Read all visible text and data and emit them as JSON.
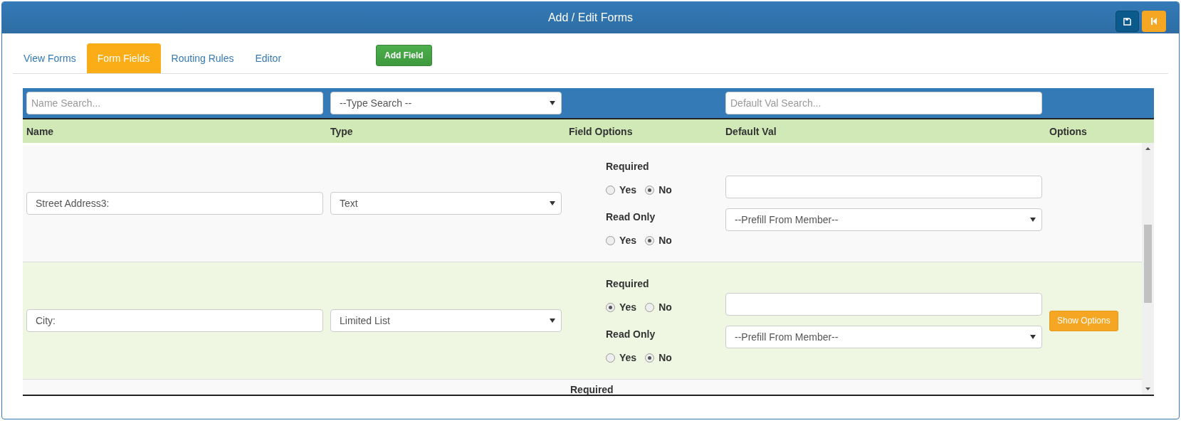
{
  "window": {
    "title": "Add / Edit Forms"
  },
  "tabs": [
    {
      "label": "View Forms",
      "selected": false
    },
    {
      "label": "Form Fields",
      "selected": true
    },
    {
      "label": "Routing Rules",
      "selected": false
    },
    {
      "label": "Editor",
      "selected": false
    }
  ],
  "add_button": "Add Field",
  "filters": {
    "name": {
      "placeholder": "Name Search..."
    },
    "type": {
      "value": "--Type Search --"
    },
    "default_val": {
      "placeholder": "Default Val Search..."
    }
  },
  "table": {
    "columns": [
      "Name",
      "Type",
      "Field Options",
      "Default Val",
      "Options"
    ],
    "rows": [
      {
        "name": "Street Address3:",
        "type": "Text",
        "highlighted": false,
        "groups": [
          {
            "label": "Required",
            "options": [
              {
                "label": "Yes",
                "selected": false
              },
              {
                "label": "No",
                "selected": true
              }
            ]
          },
          {
            "label": "Read Only",
            "options": [
              {
                "label": "Yes",
                "selected": false
              },
              {
                "label": "No",
                "selected": true
              }
            ]
          }
        ],
        "prefill": "--Prefill From Member--"
      },
      {
        "name": "City:",
        "type": "Limited List",
        "highlighted": true,
        "groups": [
          {
            "label": "Required",
            "options": [
              {
                "label": "Yes",
                "selected": true
              },
              {
                "label": "No",
                "selected": false
              }
            ]
          },
          {
            "label": "Read Only",
            "options": [
              {
                "label": "Yes",
                "selected": false
              },
              {
                "label": "No",
                "selected": true
              }
            ]
          }
        ],
        "prefill": "--Prefill From Member--",
        "options_button": "Show Options"
      }
    ],
    "partial_row_label": "Required"
  }
}
